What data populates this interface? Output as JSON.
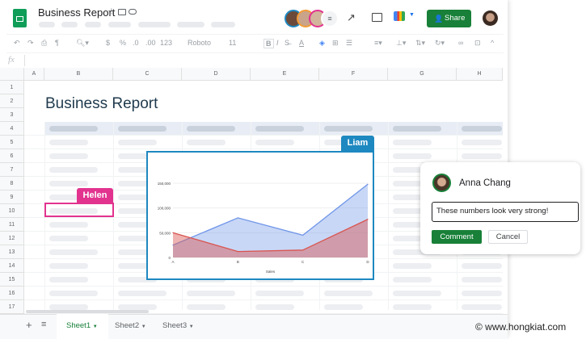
{
  "app": {
    "title": "Business Report",
    "share_label": "Share",
    "colors": {
      "brand": "#0f9d58",
      "share": "#188038"
    }
  },
  "toolbar": {
    "font": "Roboto",
    "size": "11",
    "zoom_icon": "zoom-icon",
    "number_format": "123",
    "percent": "%",
    "currency": "$",
    "dec_less": ".0",
    "dec_more": ".00",
    "bold": "B",
    "italic": "I"
  },
  "formula": {
    "fx": "fx"
  },
  "columns": [
    "A",
    "B",
    "C",
    "D",
    "E",
    "F",
    "G",
    "H"
  ],
  "rows": [
    "1",
    "2",
    "3",
    "4",
    "5",
    "6",
    "7",
    "8",
    "9",
    "10",
    "11",
    "12",
    "13",
    "14",
    "15",
    "16",
    "17"
  ],
  "sheet": {
    "heading": "Business Report"
  },
  "collaborators": {
    "liam": {
      "name": "Liam",
      "color": "#1e88c0"
    },
    "helen": {
      "name": "Helen",
      "color": "#e2338f"
    }
  },
  "tabs": [
    {
      "label": "Sheet1",
      "active": true
    },
    {
      "label": "Sheet2"
    },
    {
      "label": "Sheet3"
    }
  ],
  "comment": {
    "author": "Anna Chang",
    "text": "These numbers look very strong!",
    "submit_label": "Comment",
    "cancel_label": "Cancel"
  },
  "watermark": "© www.hongkiat.com",
  "chart_data": {
    "type": "area",
    "categories": [
      "A",
      "B",
      "C",
      "D"
    ],
    "xlabel": "Sales",
    "ylim": [
      0,
      150000
    ],
    "yticks": [
      "0",
      "50,000",
      "100,000",
      "150,000"
    ],
    "grid": true,
    "series": [
      {
        "values": [
          25000,
          80000,
          45000,
          148000
        ],
        "color": "#6f95e8"
      },
      {
        "values": [
          50000,
          12000,
          15000,
          77000
        ],
        "color": "#d9544f"
      }
    ]
  }
}
